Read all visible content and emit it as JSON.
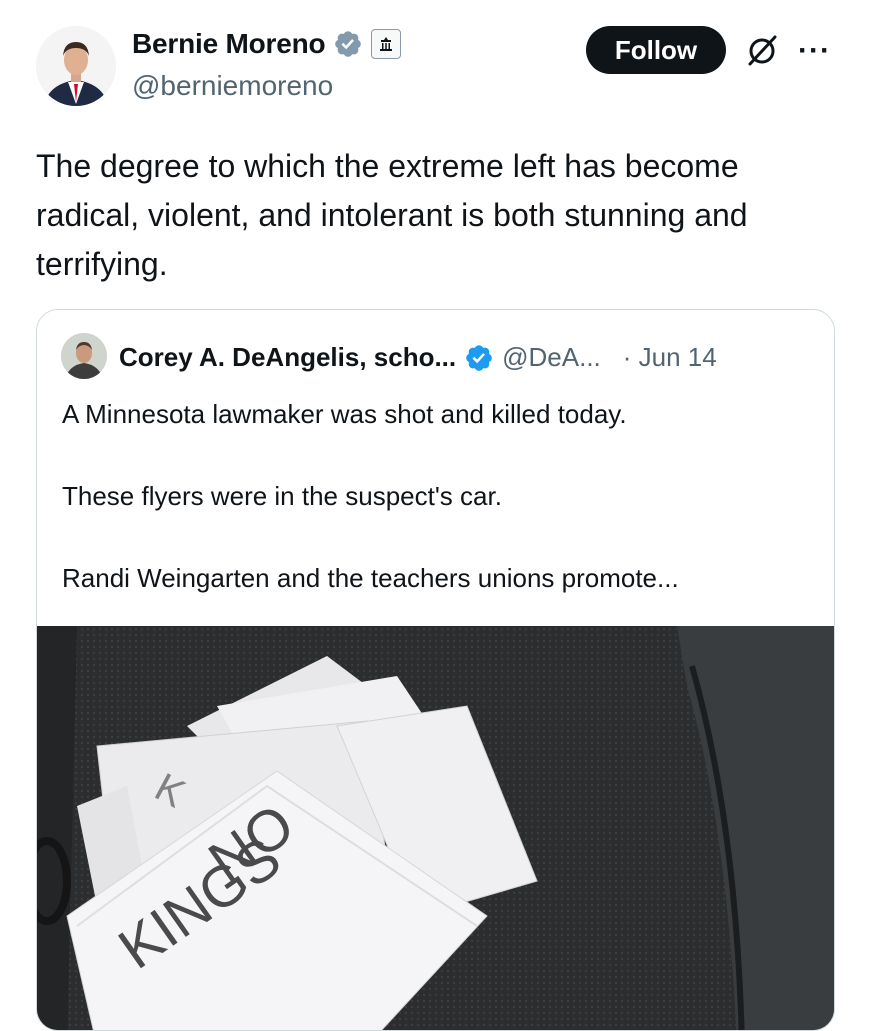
{
  "author": {
    "name": "Bernie Moreno",
    "handle": "@berniemoreno",
    "verified_badge": "blue-check-icon",
    "affiliation_badge": "government-building-icon"
  },
  "actions": {
    "follow_label": "Follow",
    "grok_icon": "grok-icon",
    "more_icon": "more-icon",
    "more_label": "···"
  },
  "tweet": {
    "text": "The degree to which the extreme left has become radical, violent, and intolerant is both stunning and terrifying."
  },
  "quoted": {
    "name": "Corey A. DeAngelis, scho...",
    "handle": "@DeA...",
    "date": "· Jun 14",
    "paragraphs": [
      "A Minnesota lawmaker was shot and killed today.",
      "These flyers were in the suspect's car.",
      "Randi Weingarten and the teachers unions promote..."
    ],
    "image_text_1": "NO",
    "image_text_2": "KINGS"
  },
  "colors": {
    "accent": "#1d9bf0",
    "text": "#0f1419",
    "secondary": "#536471",
    "border": "#cfd9de"
  }
}
